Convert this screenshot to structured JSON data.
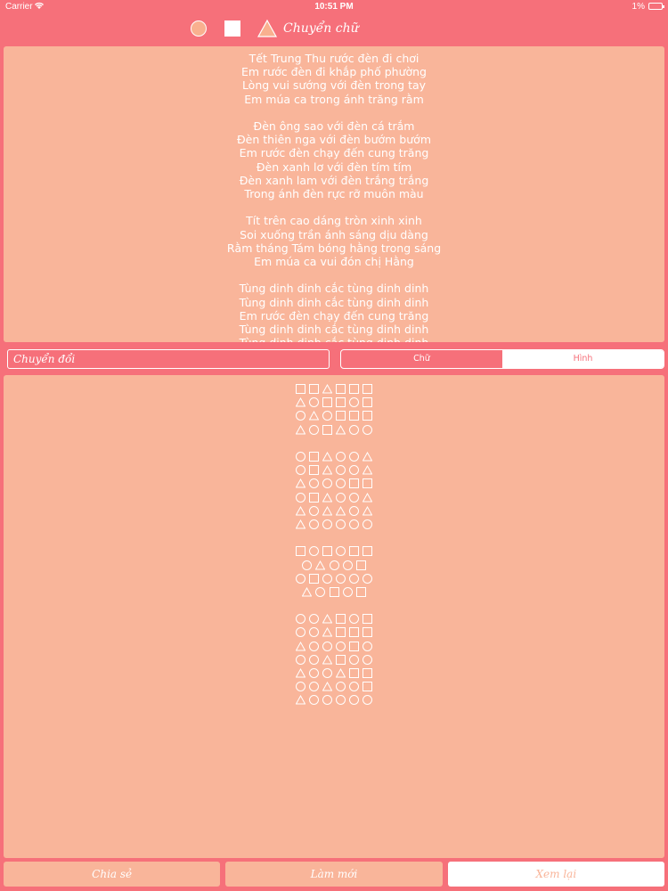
{
  "status_bar": {
    "carrier": "Carrier",
    "time": "10:51 PM",
    "battery": "1%"
  },
  "toolbar": {
    "toggle_label": "Chuyển chữ"
  },
  "poem": {
    "lines": [
      "Tết Trung Thu rước đèn đi chơi",
      "Em rước đèn đi khắp phố phường",
      "Lòng vui sướng với đèn trong tay",
      "Em múa ca trong ánh trăng rằm",
      "",
      "Đèn ông sao với đèn cá trắm",
      "Đèn thiên nga với đèn bướm bướm",
      "Em rước đèn chạy đến cung trăng",
      "Đèn xanh lơ với đèn tím tím",
      "Đèn xanh lam với đèn trắng trắng",
      "Trong ánh đèn rực rỡ muôn màu",
      "",
      "Tít trên cao dáng tròn xinh xinh",
      "Soi xuống trần ánh sáng dịu dàng",
      "Rằm tháng Tám bóng hằng trong sáng",
      "Em múa ca vui đón chị Hằng",
      "",
      "Tùng dinh dinh cắc tùng dinh dinh",
      "Tùng dinh dinh cắc tùng dinh dinh",
      "Em rước đèn chạy đến cung trăng",
      "Tùng dinh dinh cắc tùng dinh dinh",
      "Tùng dinh dinh cắc tùng dinh dinh"
    ]
  },
  "convert": {
    "placeholder": "Chuyển đổi"
  },
  "mode_switch": {
    "text_label": "Chữ",
    "shape_label": "Hình"
  },
  "shape_output": {
    "rows": [
      "sstsss",
      "tcsscs",
      "ctcsss",
      "tcstcc",
      "",
      "cstcct",
      "cstcct",
      "tcccss",
      "cstcct",
      "tcttct",
      "tccccc",
      "",
      "scscss",
      "ctccs",
      "cscccc",
      "tcscs",
      "",
      "cctscs",
      "cctsss",
      "tcccsc",
      "cctscc",
      "tcctss",
      "cctccs",
      "tccccc"
    ]
  },
  "buttons": {
    "save": "Chia sẻ",
    "reset": "Làm mới",
    "review": "Xem lại"
  },
  "colors": {
    "background": "#F6707A",
    "panel": "#F9B59A",
    "text": "#ffffff"
  }
}
